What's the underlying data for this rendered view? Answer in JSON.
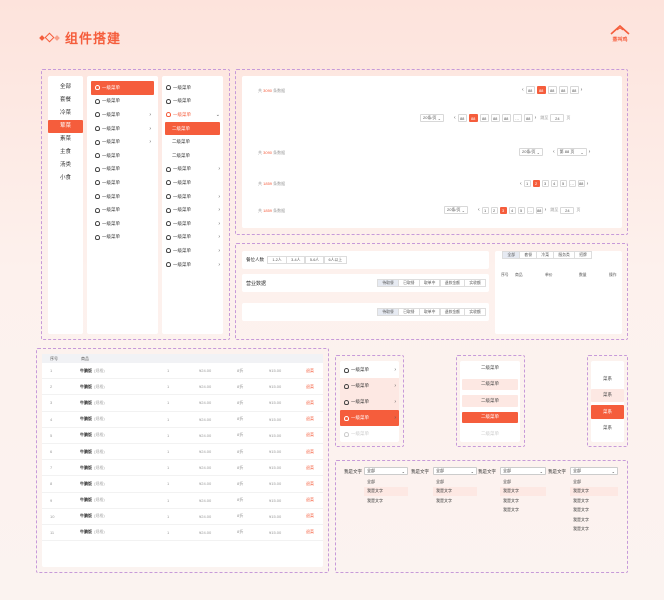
{
  "header": {
    "title": "组件搭建",
    "logo_text": "蒸叫鸡"
  },
  "colors": {
    "accent": "#f55d3c",
    "bg": "#fde3dc",
    "dash": "#c79ad9"
  },
  "categories": [
    "全部",
    "套餐",
    "冷菜",
    "荤菜",
    "素菜",
    "主食",
    "汤类",
    "小食"
  ],
  "menu_col2": {
    "items": [
      "一级菜单",
      "一级菜单",
      "一级菜单",
      "一级菜单",
      "一级菜单",
      "一级菜单",
      "一级菜单",
      "一级菜单",
      "一级菜单",
      "一级菜单",
      "一级菜单",
      "一级菜单"
    ]
  },
  "menu_col3": {
    "top": [
      "一级菜单",
      "一级菜单",
      "一级菜单"
    ],
    "subs": [
      "二级菜单",
      "二级菜单",
      "二级菜单"
    ],
    "rest": [
      "一级菜单",
      "一级菜单",
      "一级菜单",
      "一级菜单",
      "一级菜单",
      "一级菜单",
      "一级菜单",
      "一级菜单"
    ]
  },
  "pagination": {
    "row1": {
      "total_prefix": "共",
      "total": "3090",
      "total_suffix": "条数据",
      "pages": [
        "88",
        "88",
        "88",
        "88",
        "88"
      ],
      "prev": "‹",
      "next": "›"
    },
    "row2": {
      "size": "20条/页",
      "pages": [
        "88",
        "88",
        "88",
        "88",
        "88"
      ],
      "ellipsis": "…",
      "last": "88",
      "goto": "跳至",
      "goto_val": "24",
      "page_unit": "页"
    },
    "row3": {
      "total_prefix": "共",
      "total": "3090",
      "total_suffix": "条数据",
      "size": "20条/页",
      "jump": "第 88 页"
    },
    "row4": {
      "total_prefix": "共",
      "total": "1859",
      "total_suffix": "条数据",
      "pages": [
        "1",
        "2",
        "3",
        "4",
        "5"
      ],
      "ellipsis": "…",
      "last": "88"
    },
    "row5": {
      "total_prefix": "共",
      "total": "1859",
      "total_suffix": "条数据",
      "size": "20条/页",
      "pages": [
        "1",
        "2",
        "3",
        "4",
        "5"
      ],
      "ellipsis": "…",
      "last": "88",
      "goto": "跳至",
      "goto_val": "24",
      "page_unit": "页"
    }
  },
  "filters": {
    "people_label": "餐位人数",
    "people": [
      "1-2人",
      "3-4人",
      "5-6人",
      "6人以上"
    ],
    "revenue_label": "营业数据",
    "status_a": [
      "待取餐",
      "已取餐",
      "取单中",
      "退款金额",
      "实收额"
    ],
    "status_b": [
      "待取餐",
      "已取餐",
      "取单中",
      "退款金额",
      "实收额"
    ],
    "tabs": [
      "全部",
      "套餐",
      "冷菜",
      "服务类",
      "招牌"
    ],
    "cols": [
      "序号",
      "商品",
      "单价",
      "数量",
      "操作"
    ]
  },
  "order_table": {
    "headers": [
      "序号",
      "商品"
    ],
    "rows": [
      {
        "no": "1",
        "name": "牛腩饭",
        "spec": "(规格)",
        "qty": "1",
        "price": "¥24.00",
        "disc": "8折",
        "total": "¥15.00",
        "op": "退菜"
      },
      {
        "no": "2",
        "name": "牛腩饭",
        "spec": "(规格)",
        "qty": "1",
        "price": "¥24.00",
        "disc": "8折",
        "total": "¥15.00",
        "op": "退菜"
      },
      {
        "no": "3",
        "name": "牛腩饭",
        "spec": "(规格)",
        "qty": "1",
        "price": "¥24.00",
        "disc": "8折",
        "total": "¥15.00",
        "op": "退菜"
      },
      {
        "no": "4",
        "name": "牛腩饭",
        "spec": "(规格)",
        "qty": "1",
        "price": "¥24.00",
        "disc": "8折",
        "total": "¥15.00",
        "op": "退菜"
      },
      {
        "no": "5",
        "name": "牛腩饭",
        "spec": "(规格)",
        "qty": "1",
        "price": "¥24.00",
        "disc": "8折",
        "total": "¥15.00",
        "op": "退菜"
      },
      {
        "no": "6",
        "name": "牛腩饭",
        "spec": "(规格)",
        "qty": "1",
        "price": "¥24.00",
        "disc": "8折",
        "total": "¥15.00",
        "op": "退菜"
      },
      {
        "no": "7",
        "name": "牛腩饭",
        "spec": "(规格)",
        "qty": "1",
        "price": "¥24.00",
        "disc": "8折",
        "total": "¥15.00",
        "op": "退菜"
      },
      {
        "no": "8",
        "name": "牛腩饭",
        "spec": "(规格)",
        "qty": "1",
        "price": "¥24.00",
        "disc": "8折",
        "total": "¥15.00",
        "op": "退菜"
      },
      {
        "no": "9",
        "name": "牛腩饭",
        "spec": "(规格)",
        "qty": "1",
        "price": "¥24.00",
        "disc": "8折",
        "total": "¥15.00",
        "op": "退菜"
      },
      {
        "no": "10",
        "name": "牛腩饭",
        "spec": "(规格)",
        "qty": "1",
        "price": "¥24.00",
        "disc": "8折",
        "total": "¥15.00",
        "op": "退菜"
      },
      {
        "no": "11",
        "name": "牛腩饭",
        "spec": "(规格)",
        "qty": "1",
        "price": "¥24.00",
        "disc": "8折",
        "total": "¥15.00",
        "op": "退菜"
      }
    ]
  },
  "menu_states": [
    "一级菜单",
    "一级菜单",
    "一级菜单",
    "一级菜单",
    "一级菜单"
  ],
  "submenu_states": [
    "二级菜单",
    "二级菜单",
    "二级菜单",
    "二级菜单",
    "二级菜单"
  ],
  "cat_states": [
    "菜系",
    "菜系",
    "菜系",
    "菜系"
  ],
  "dropdowns": [
    {
      "label": "我是文字",
      "value": "全部",
      "options": []
    },
    {
      "label": "我是文字",
      "value": "全部",
      "options": [
        "全部",
        "我是文字",
        "我是文字"
      ]
    },
    {
      "label": "我是文字",
      "value": "全部",
      "options": [
        "全部",
        "我是文字",
        "我是文字"
      ]
    },
    {
      "label": "我是文字",
      "value": "全部",
      "options": [
        "全部",
        "我是文字",
        "我是文字",
        "我是文字"
      ]
    },
    {
      "label": "我是文字",
      "value": "全部",
      "options": [
        "全部",
        "我是文字",
        "我是文字",
        "我是文字",
        "我是文字",
        "我是文字"
      ]
    }
  ]
}
